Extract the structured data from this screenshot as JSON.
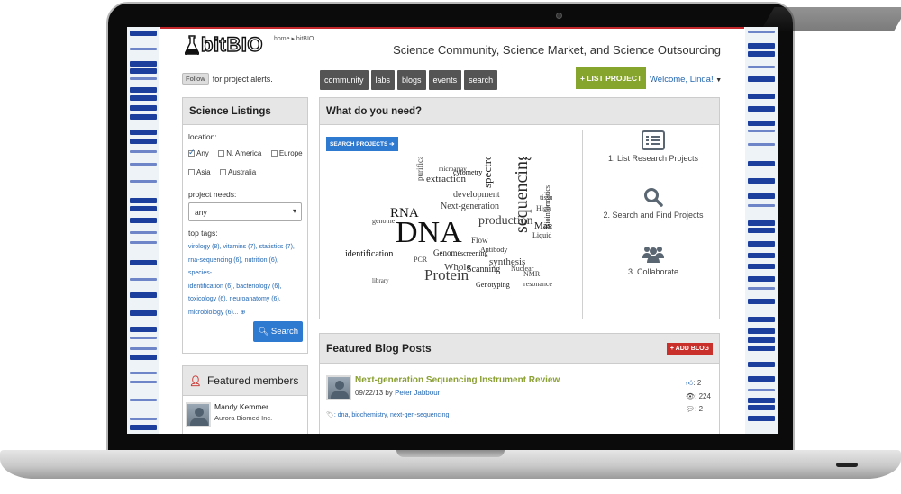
{
  "brand": {
    "logo": "bitBIO",
    "breadcrumb": "home ▸ bitBIO",
    "tagline": "Science Community, Science Market, and Science Outsourcing"
  },
  "follow": {
    "button": "Follow",
    "text": "for project alerts."
  },
  "nav": [
    "community",
    "labs",
    "blogs",
    "events",
    "search"
  ],
  "list_project": "+ LIST PROJECT",
  "welcome": "Welcome, Linda!",
  "listings": {
    "title": "Science Listings",
    "location_label": "location:",
    "locations": [
      {
        "label": "Any",
        "checked": true
      },
      {
        "label": "N. America",
        "checked": false
      },
      {
        "label": "Europe",
        "checked": false
      },
      {
        "label": "Asia",
        "checked": false
      },
      {
        "label": "Australia",
        "checked": false
      }
    ],
    "needs_label": "project needs:",
    "needs_value": "any",
    "tags_label": "top tags:",
    "tags": [
      "virology (8), vitamins (7), statistics (7),",
      "rna-sequencing (6), nutrition (6), species-",
      "identification (6), bacteriology (6),",
      "toxicology (6), neuroanatomy (6),",
      "microbiology (6)... ⊕"
    ],
    "search": "Search"
  },
  "members": {
    "title": "Featured members",
    "name": "Mandy Kemmer",
    "org": "Aurora Biomed Inc."
  },
  "need": {
    "title": "What do you need?",
    "search_btn": "SEARCH PROJECTS ➔",
    "steps": [
      {
        "icon": "list-icon",
        "label": "1. List Research Projects"
      },
      {
        "icon": "search-icon",
        "label": "2. Search and Find Projects"
      },
      {
        "icon": "people-icon",
        "label": "3. Collaborate"
      }
    ]
  },
  "cloud": {
    "words": [
      "DNA",
      "sequencing",
      "Protein",
      "production",
      "RNA",
      "spectrometry",
      "Next-generation",
      "synthesis",
      "identification",
      "extraction",
      "development",
      "purification",
      "Mass",
      "Bioinformatics",
      "Whole",
      "PCR",
      "Genome",
      "Scanning",
      "NMR",
      "resonance",
      "Genotyping",
      "Antibody",
      "Flow",
      "Nuclear",
      "cytometry",
      "microarray",
      "library",
      "genome",
      "screening",
      "Liquid",
      "High",
      "tissue"
    ]
  },
  "blog": {
    "title": "Featured Blog Posts",
    "add": "+ ADD BLOG",
    "post_title": "Next-generation Sequencing Instrument Review",
    "date": "09/22/13",
    "by": "by",
    "author": "Peter Jabbour",
    "tags": ": dna, biochemistry, next-gen-sequencing",
    "likes": "2",
    "views": "224",
    "comments": "2"
  },
  "colors": {
    "accent_red": "#c3262b",
    "nav_gray": "#545454",
    "list_green": "#86a52d",
    "link_blue": "#2468b3",
    "button_blue": "#2f7ad1"
  }
}
